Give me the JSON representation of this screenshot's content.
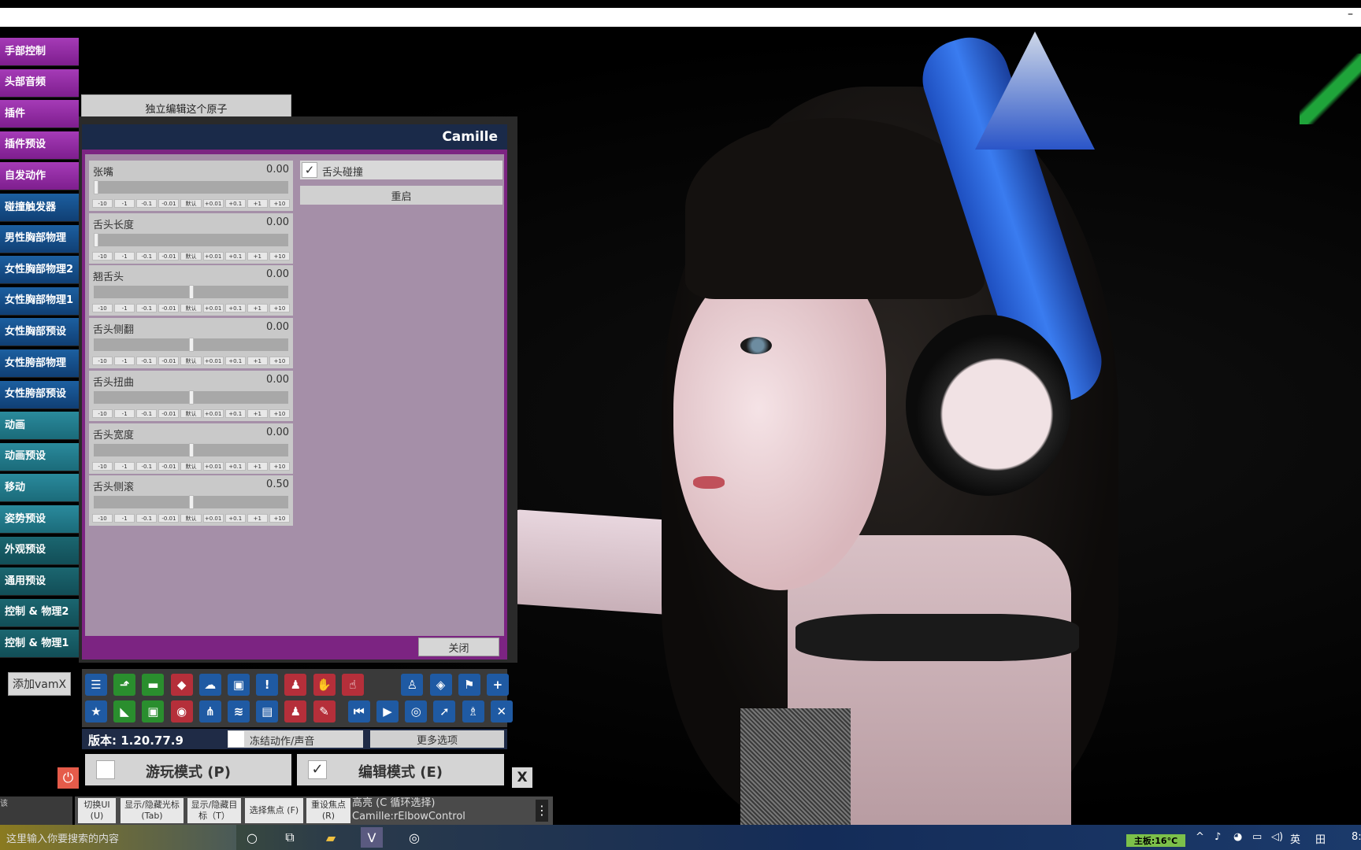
{
  "window": {
    "minimize_glyph": "–"
  },
  "sidebar": {
    "items": [
      {
        "label": "手部控制",
        "color": "purple"
      },
      {
        "label": "头部音频",
        "color": "purple"
      },
      {
        "label": "插件",
        "color": "purple"
      },
      {
        "label": "插件预设",
        "color": "purple"
      },
      {
        "label": "自发动作",
        "color": "purple"
      },
      {
        "label": "碰撞触发器",
        "color": "blue"
      },
      {
        "label": "男性胸部物理",
        "color": "blue"
      },
      {
        "label": "女性胸部物理2",
        "color": "blue"
      },
      {
        "label": "女性胸部物理1",
        "color": "blue"
      },
      {
        "label": "女性胸部预设",
        "color": "blue"
      },
      {
        "label": "女性胯部物理",
        "color": "blue"
      },
      {
        "label": "女性胯部预设",
        "color": "blue"
      },
      {
        "label": "动画",
        "color": "teal"
      },
      {
        "label": "动画预设",
        "color": "teal"
      },
      {
        "label": "移动",
        "color": "teal"
      },
      {
        "label": "姿势预设",
        "color": "teal"
      },
      {
        "label": "外观预设",
        "color": "dteal"
      },
      {
        "label": "通用预设",
        "color": "dteal"
      },
      {
        "label": "控制 & 物理2",
        "color": "dteal"
      },
      {
        "label": "控制 & 物理1",
        "color": "dteal"
      }
    ],
    "add_button": "添加vamX"
  },
  "independent_edit": "独立编辑这个原子",
  "panel": {
    "title": "Camille",
    "sliders": [
      {
        "label": "张嘴",
        "value": "0.00",
        "level": 0.0
      },
      {
        "label": "舌头长度",
        "value": "0.00",
        "level": 0.0
      },
      {
        "label": "翘舌头",
        "value": "0.00",
        "level": 0.5
      },
      {
        "label": "舌头侧翻",
        "value": "0.00",
        "level": 0.5
      },
      {
        "label": "舌头扭曲",
        "value": "0.00",
        "level": 0.5
      },
      {
        "label": "舌头宽度",
        "value": "0.00",
        "level": 0.5
      },
      {
        "label": "舌头侧滚",
        "value": "0.50",
        "level": 0.5
      }
    ],
    "step_buttons": [
      "-10",
      "-1",
      "-0.1",
      "-0.01",
      "默认",
      "+0.01",
      "+0.1",
      "+1",
      "+10"
    ],
    "tongue_collision": {
      "label": "舌头碰撞",
      "checked": true,
      "check_glyph": "✓"
    },
    "restart": "重启",
    "close": "关闭"
  },
  "toolbar": {
    "row1": [
      {
        "icon": "menu-icon",
        "glyph": "☰",
        "color": "blue"
      },
      {
        "icon": "open-scene-icon",
        "glyph": "⬏",
        "color": "green"
      },
      {
        "icon": "folder-icon",
        "glyph": "▬",
        "color": "green"
      },
      {
        "icon": "save-icon",
        "glyph": "◆",
        "color": "red"
      },
      {
        "icon": "cloud-icon",
        "glyph": "☁",
        "color": "blue"
      },
      {
        "icon": "cube-icon",
        "glyph": "▣",
        "color": "blue"
      },
      {
        "icon": "alert-icon",
        "glyph": "!",
        "color": "blue"
      },
      {
        "icon": "add-person-icon",
        "glyph": "♟",
        "color": "red"
      },
      {
        "icon": "hand-icon",
        "glyph": "✋",
        "color": "red"
      },
      {
        "icon": "pointer-hand-icon",
        "glyph": "☝",
        "color": "red"
      },
      {
        "icon": "person-icon",
        "glyph": "♙",
        "color": "blue"
      },
      {
        "icon": "unity-icon",
        "glyph": "◈",
        "color": "blue"
      },
      {
        "icon": "flag-icon",
        "glyph": "⚑",
        "color": "blue"
      },
      {
        "icon": "plus-icon",
        "glyph": "+",
        "color": "blue"
      }
    ],
    "row2": [
      {
        "icon": "star-icon",
        "glyph": "★",
        "color": "blue"
      },
      {
        "icon": "iron-icon",
        "glyph": "◣",
        "color": "green"
      },
      {
        "icon": "camera-folder-icon",
        "glyph": "▣",
        "color": "green"
      },
      {
        "icon": "camera-icon",
        "glyph": "◉",
        "color": "red"
      },
      {
        "icon": "nodes-icon",
        "glyph": "⋔",
        "color": "blue"
      },
      {
        "icon": "layers-icon",
        "glyph": "≋",
        "color": "blue"
      },
      {
        "icon": "document-icon",
        "glyph": "▤",
        "color": "blue"
      },
      {
        "icon": "remove-person-icon",
        "glyph": "♟",
        "color": "red"
      },
      {
        "icon": "tool-hand-icon",
        "glyph": "✎",
        "color": "red"
      },
      {
        "icon": "skip-back-icon",
        "glyph": "⏮",
        "color": "blue"
      },
      {
        "icon": "play-icon",
        "glyph": "▶",
        "color": "blue"
      },
      {
        "icon": "target-icon",
        "glyph": "◎",
        "color": "blue"
      },
      {
        "icon": "cursor-icon",
        "glyph": "➚",
        "color": "blue"
      },
      {
        "icon": "group-icon",
        "glyph": "♗",
        "color": "blue"
      },
      {
        "icon": "wrench-icon",
        "glyph": "✕",
        "color": "blue"
      }
    ],
    "version": "版本: 1.20.77.9",
    "freeze": "冻结动作/声音",
    "more_options": "更多选项"
  },
  "modes": {
    "play": {
      "label": "游玩模式 (P)",
      "checked": false
    },
    "edit": {
      "label": "编辑模式 (E)",
      "checked": true,
      "check_glyph": "✓"
    },
    "close_x": "X",
    "power_glyph": "⏻"
  },
  "hints": [
    {
      "text": "切换UI (U)"
    },
    {
      "text": "显示/隐藏光标 (Tab)"
    },
    {
      "text": "显示/隐藏目标（T）"
    },
    {
      "text": "选择焦点 (F)"
    },
    {
      "text": "重设焦点 (R)"
    }
  ],
  "highlight": {
    "line1": "高亮 (C 循环选择)",
    "line2": "Camille:rElbowControl"
  },
  "left_hint": "该",
  "taskbar": {
    "search_placeholder": "这里输入你要搜索的内容",
    "temperature": "主板:16°C",
    "tray_lang": "英",
    "tray_ime": "田",
    "tray_time": "8:"
  },
  "colors": {
    "purple": "#9a2fae",
    "blue": "#17528f",
    "teal": "#237d8d",
    "dteal": "#165a63",
    "panel": "#7c2482"
  }
}
